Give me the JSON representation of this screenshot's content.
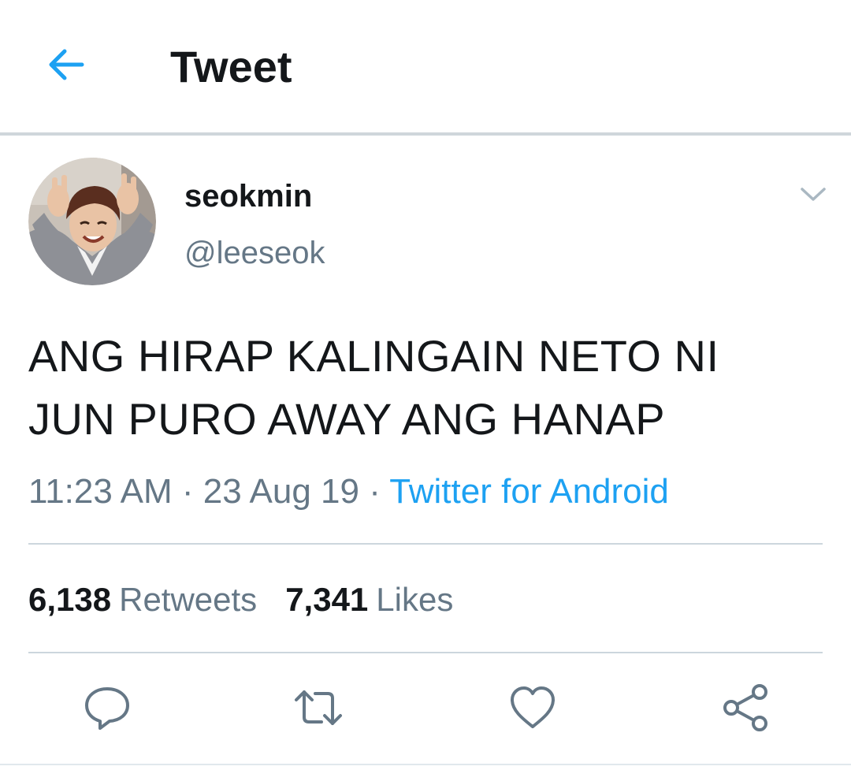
{
  "header": {
    "title": "Tweet",
    "back_icon": "arrow-left-icon"
  },
  "tweet": {
    "author": {
      "name": "seokmin",
      "handle": "@leeseok"
    },
    "text": "ANG HIRAP KALINGAIN NETO NI\nJUN PURO AWAY ANG HANAP",
    "time": "11:23 AM",
    "separator": "·",
    "date": "23 Aug 19",
    "source": "Twitter for Android",
    "stats": {
      "retweets_count": "6,138",
      "retweets_label": "Retweets",
      "likes_count": "7,341",
      "likes_label": "Likes"
    },
    "actions": [
      "reply-icon",
      "retweet-icon",
      "like-icon",
      "share-icon"
    ]
  },
  "colors": {
    "accent": "#1da1f2",
    "text_primary": "#14171a",
    "text_secondary": "#657786",
    "divider": "#ccd6dd"
  }
}
